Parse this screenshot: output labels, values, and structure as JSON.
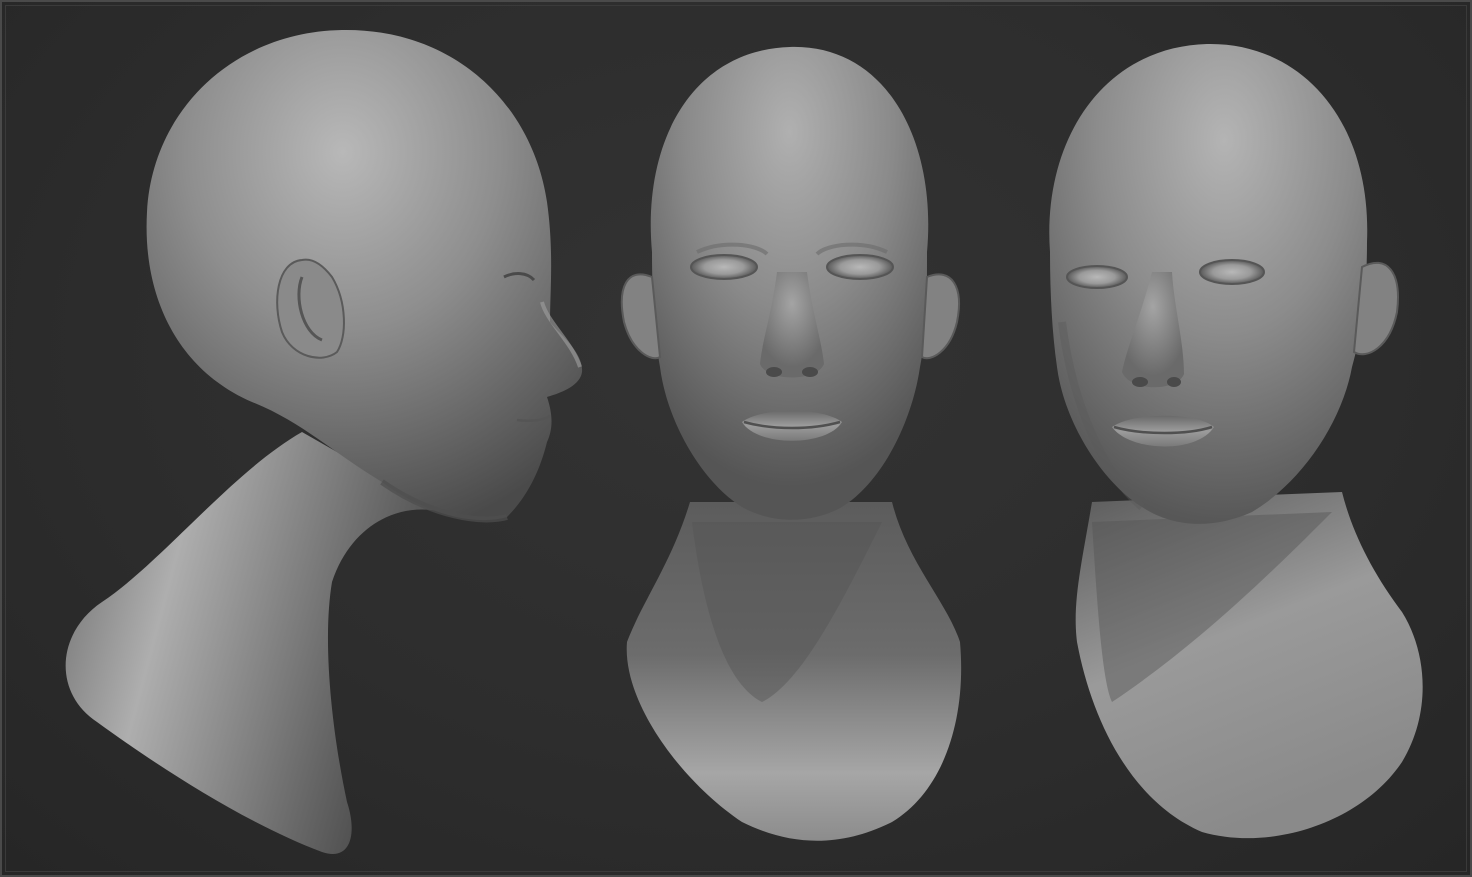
{
  "scene": {
    "background_color": "#2d2d2d",
    "frame_color": "#4a4a4a",
    "material_color": "#8a8a8a",
    "views": [
      {
        "name": "profile-view",
        "description_icon": "head-profile-icon"
      },
      {
        "name": "front-view",
        "description_icon": "head-front-icon"
      },
      {
        "name": "three-quarter-view",
        "description_icon": "head-three-quarter-icon"
      }
    ]
  }
}
